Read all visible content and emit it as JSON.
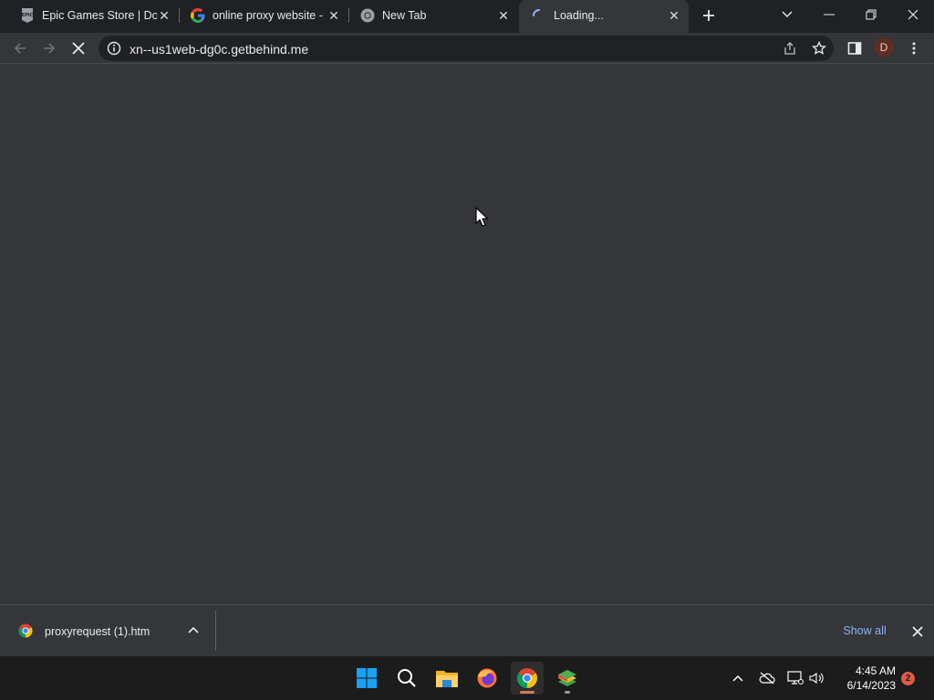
{
  "tabs": [
    {
      "title": "Epic Games Store | Dow",
      "icon": "epic-games-icon",
      "active": false
    },
    {
      "title": "online proxy website - ",
      "icon": "google-icon",
      "active": false
    },
    {
      "title": "New Tab",
      "icon": "chrome-icon",
      "active": false
    },
    {
      "title": "Loading...",
      "icon": "loading-spinner-icon",
      "active": true
    }
  ],
  "toolbar": {
    "url": "xn--us1web-dg0c.getbehind.me",
    "profile_initial": "D"
  },
  "download_shelf": {
    "file_name": "proxyrequest (1).htm",
    "show_all_label": "Show all"
  },
  "taskbar": {
    "time": "4:45 AM",
    "date": "6/14/2023",
    "notification_count": "2",
    "apps": [
      "windows-start-icon",
      "search-icon",
      "file-explorer-icon",
      "firefox-icon",
      "chrome-icon",
      "bluestacks-icon"
    ]
  },
  "colors": {
    "accent_link": "#8ab4f8",
    "tab_bar": "#202124",
    "content_bg": "#35363a",
    "taskbar_bg": "#1c1c1c",
    "notification_badge": "#e05a47"
  }
}
